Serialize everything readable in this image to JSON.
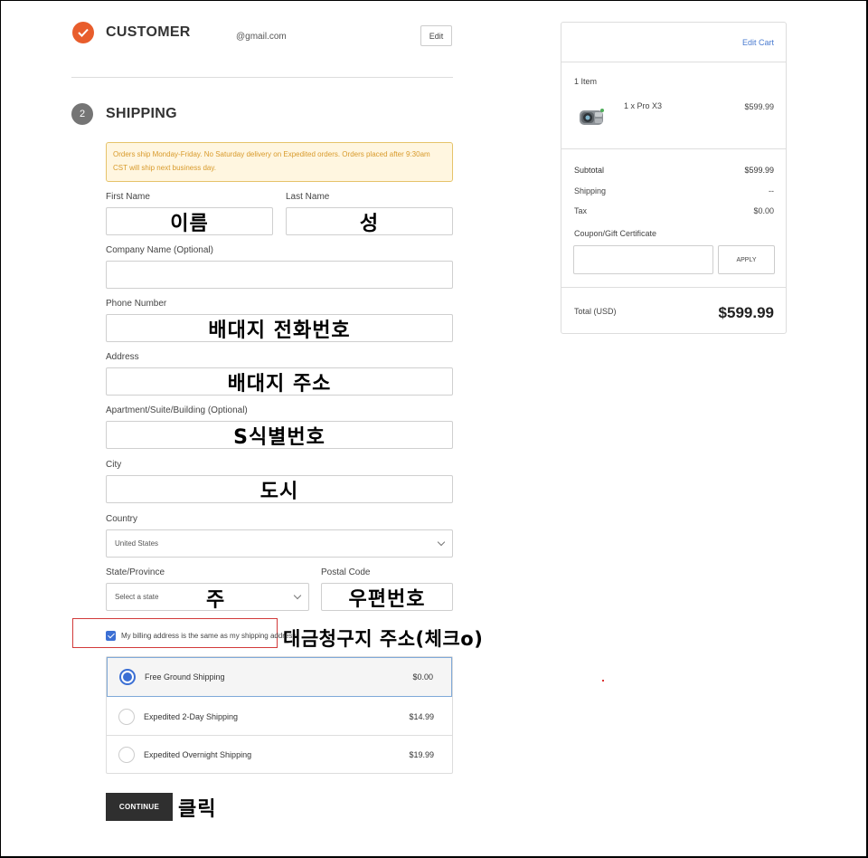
{
  "customer": {
    "title": "CUSTOMER",
    "email": "@gmail.com",
    "edit_label": "Edit"
  },
  "shipping": {
    "step_number": "2",
    "title": "SHIPPING",
    "notice": "Orders ship Monday-Friday. No Saturday delivery on Expedited orders. Orders placed after 9:30am CST will ship next business day.",
    "fields": {
      "first_name": {
        "label": "First Name",
        "annotation": "이름"
      },
      "last_name": {
        "label": "Last Name",
        "annotation": "성"
      },
      "company": {
        "label": "Company Name (Optional)"
      },
      "phone": {
        "label": "Phone Number",
        "annotation": "배대지 전화번호"
      },
      "address": {
        "label": "Address",
        "annotation": "배대지 주소"
      },
      "apartment": {
        "label": "Apartment/Suite/Building (Optional)",
        "annotation": "S식별번호"
      },
      "city": {
        "label": "City",
        "annotation": "도시"
      },
      "country": {
        "label": "Country",
        "value": "United States"
      },
      "state": {
        "label": "State/Province",
        "placeholder": "Select a state",
        "annotation": "주"
      },
      "postal": {
        "label": "Postal Code",
        "annotation": "우편번호"
      }
    },
    "billing_same_label": "My billing address is the same as my shipping address.",
    "billing_annotation": "대금청구지 주소(체크o)",
    "options": [
      {
        "name": "Free Ground Shipping",
        "price": "$0.00",
        "selected": true
      },
      {
        "name": "Expedited 2-Day Shipping",
        "price": "$14.99",
        "selected": false
      },
      {
        "name": "Expedited Overnight Shipping",
        "price": "$19.99",
        "selected": false
      }
    ],
    "continue_label": "CONTINUE",
    "continue_annotation": "클릭"
  },
  "cart": {
    "edit_cart_label": "Edit Cart",
    "item_count": "1 Item",
    "item_name": "1 x Pro X3",
    "item_price": "$599.99",
    "subtotal_label": "Subtotal",
    "subtotal_value": "$599.99",
    "shipping_label": "Shipping",
    "shipping_value": "--",
    "tax_label": "Tax",
    "tax_value": "$0.00",
    "coupon_label": "Coupon/Gift Certificate",
    "apply_label": "APPLY",
    "total_label": "Total (USD)",
    "total_value": "$599.99"
  },
  "colors": {
    "accent_done": "#e85d2c",
    "radio_selected": "#3b6fd4",
    "annotation_box": "#d23a3a"
  }
}
